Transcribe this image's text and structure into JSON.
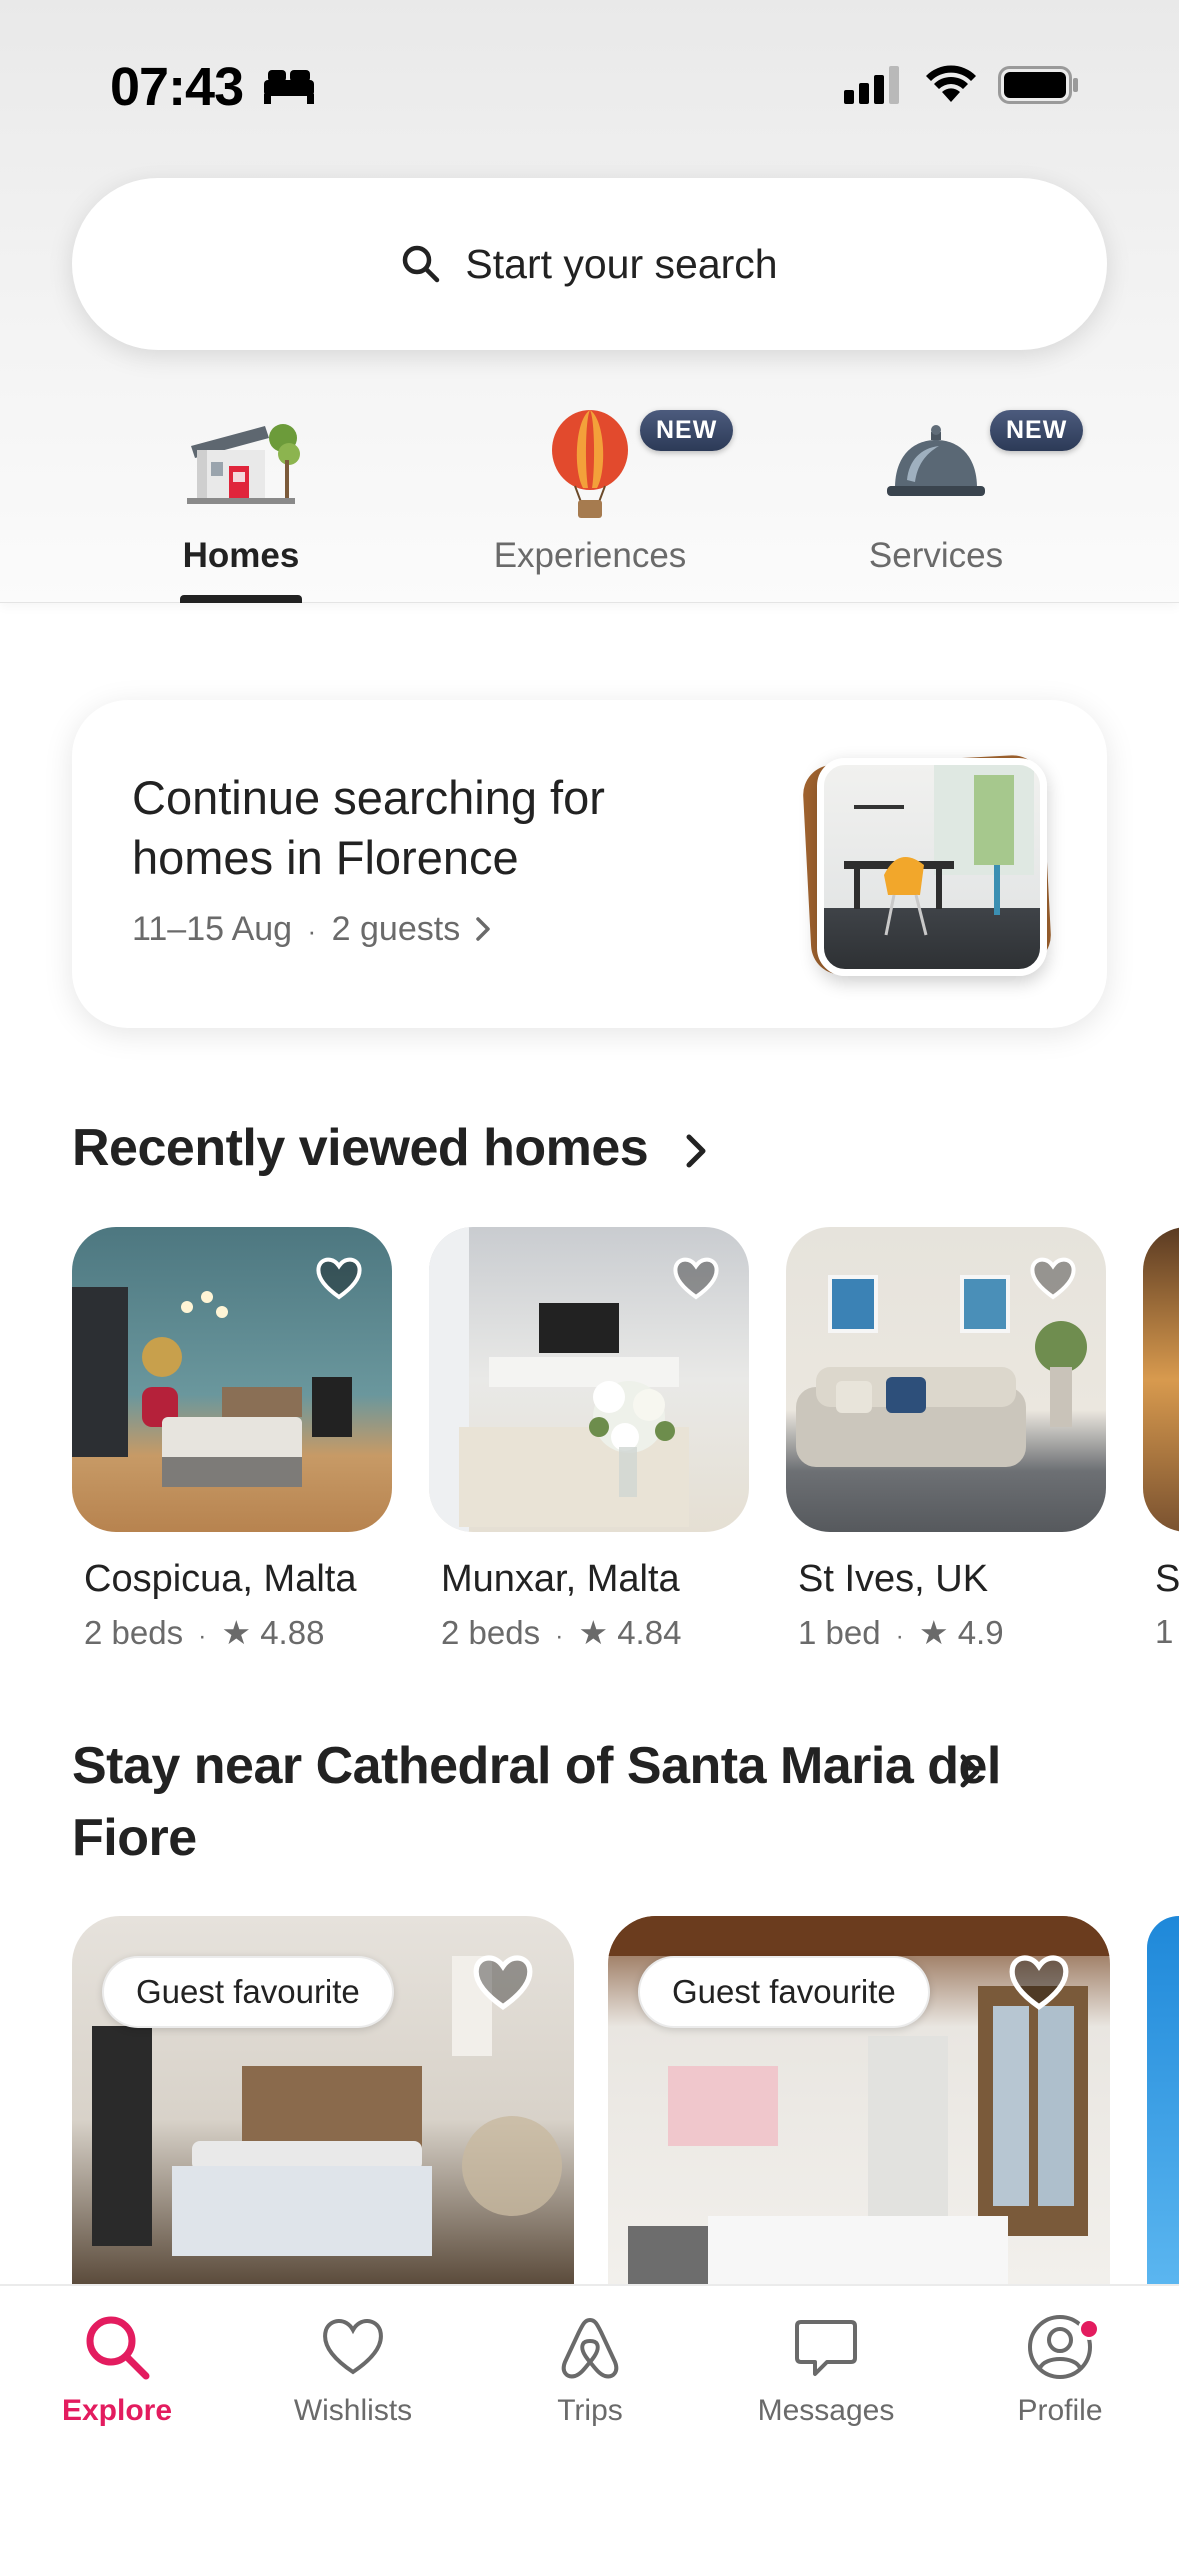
{
  "status_bar": {
    "time": "07:43",
    "focus_icon": "bed-icon",
    "signal_icon": "cellular-signal-icon",
    "wifi_icon": "wifi-icon",
    "battery_icon": "battery-icon"
  },
  "search": {
    "label": "Start your search",
    "icon": "search-icon"
  },
  "categories": [
    {
      "label": "Homes",
      "icon": "house-icon",
      "active": true,
      "badge": ""
    },
    {
      "label": "Experiences",
      "icon": "hot-air-balloon-icon",
      "active": false,
      "badge": "NEW"
    },
    {
      "label": "Services",
      "icon": "service-bell-icon",
      "active": false,
      "badge": "NEW"
    }
  ],
  "continue_card": {
    "title": "Continue searching for homes in Florence",
    "dates": "11–15 Aug",
    "separator": "·",
    "guests": "2 guests"
  },
  "recently_viewed": {
    "title": "Recently viewed homes",
    "items": [
      {
        "name": "Cospicua, Malta",
        "beds": "2 beds",
        "rating": "4.88"
      },
      {
        "name": "Munxar, Malta",
        "beds": "2 beds",
        "rating": "4.84"
      },
      {
        "name": "St Ives, UK",
        "beds": "1 bed",
        "rating": "4.9"
      },
      {
        "name": "S",
        "beds": "1",
        "rating": ""
      }
    ]
  },
  "stay_near": {
    "title": "Stay near Cathedral of Santa Maria del Fiore",
    "items": [
      {
        "badge": "Guest favourite"
      },
      {
        "badge": "Guest favourite"
      }
    ]
  },
  "bottom_nav": [
    {
      "label": "Explore",
      "icon": "search-icon",
      "active": true
    },
    {
      "label": "Wishlists",
      "icon": "heart-icon",
      "active": false
    },
    {
      "label": "Trips",
      "icon": "airbnb-logo-icon",
      "active": false
    },
    {
      "label": "Messages",
      "icon": "message-icon",
      "active": false
    },
    {
      "label": "Profile",
      "icon": "profile-icon",
      "active": false,
      "notification": true
    }
  ],
  "colors": {
    "accent": "#e31c5f",
    "text": "#222222",
    "muted": "#6a6a6a",
    "badge_bg": "#2c3a57"
  }
}
